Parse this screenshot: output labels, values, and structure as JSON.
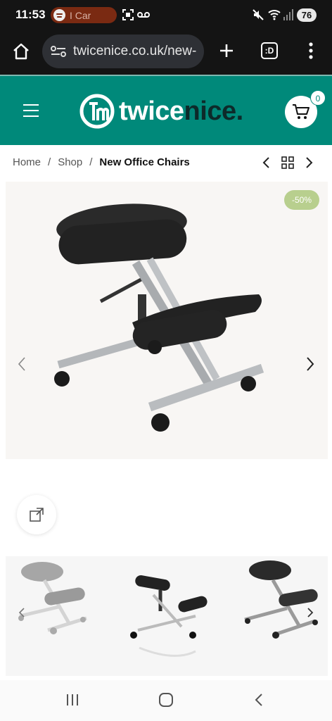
{
  "status": {
    "time": "11:53",
    "media_text": "I Car",
    "battery": "76",
    "icons": [
      "spotify-icon",
      "screenshot-icon",
      "voicemail-icon",
      "mute-icon",
      "wifi-icon",
      "signal-icon"
    ]
  },
  "browser": {
    "url": "twicenice.co.uk/new-",
    "icons": [
      "home-icon",
      "site-settings-icon",
      "new-tab-icon",
      "tab-switcher-icon",
      "menu-icon"
    ],
    "tab_count": ":D"
  },
  "site": {
    "logo_part1": "twice",
    "logo_part2": "nice.",
    "cart_count": "0",
    "brand_color": "#00897a"
  },
  "breadcrumb": {
    "items": [
      "Home",
      "Shop",
      "New Office Chairs"
    ],
    "separator": "/"
  },
  "product": {
    "discount_badge": "-50%",
    "main_image": "kneeling-chair-black-fabric",
    "thumbnails": [
      "kneeling-chair-faded",
      "kneeling-chair-side",
      "kneeling-chair-angle"
    ]
  }
}
